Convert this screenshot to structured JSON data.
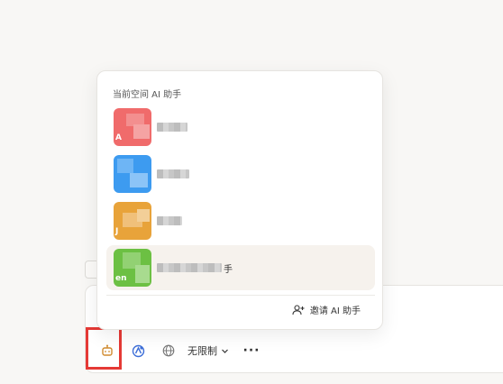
{
  "popup": {
    "title": "当前空间 AI 助手",
    "items": [
      {
        "color": "#f06b6b",
        "initial": "A",
        "name_tail": "",
        "selected": false
      },
      {
        "color": "#3d9bf0",
        "initial": "",
        "name_tail": "",
        "selected": false
      },
      {
        "color": "#e8a33a",
        "initial": "J",
        "name_tail": "",
        "selected": false
      },
      {
        "color": "#6cc043",
        "initial": "en",
        "name_tail": "手",
        "selected": true
      }
    ],
    "invite_label": "邀请 AI 助手"
  },
  "toolbar": {
    "limit_label": "无限制"
  },
  "icons": {
    "bot": "robot-icon",
    "agent": "agent-icon",
    "globe": "globe-icon",
    "chevron": "chevron-down-icon",
    "more": "more-icon",
    "invite": "user-plus-icon"
  },
  "colors": {
    "highlight": "#e53935",
    "selected_bg": "#f6f2ed",
    "bot_icon": "#d08a2e",
    "agent_icon": "#3e6fd8"
  }
}
